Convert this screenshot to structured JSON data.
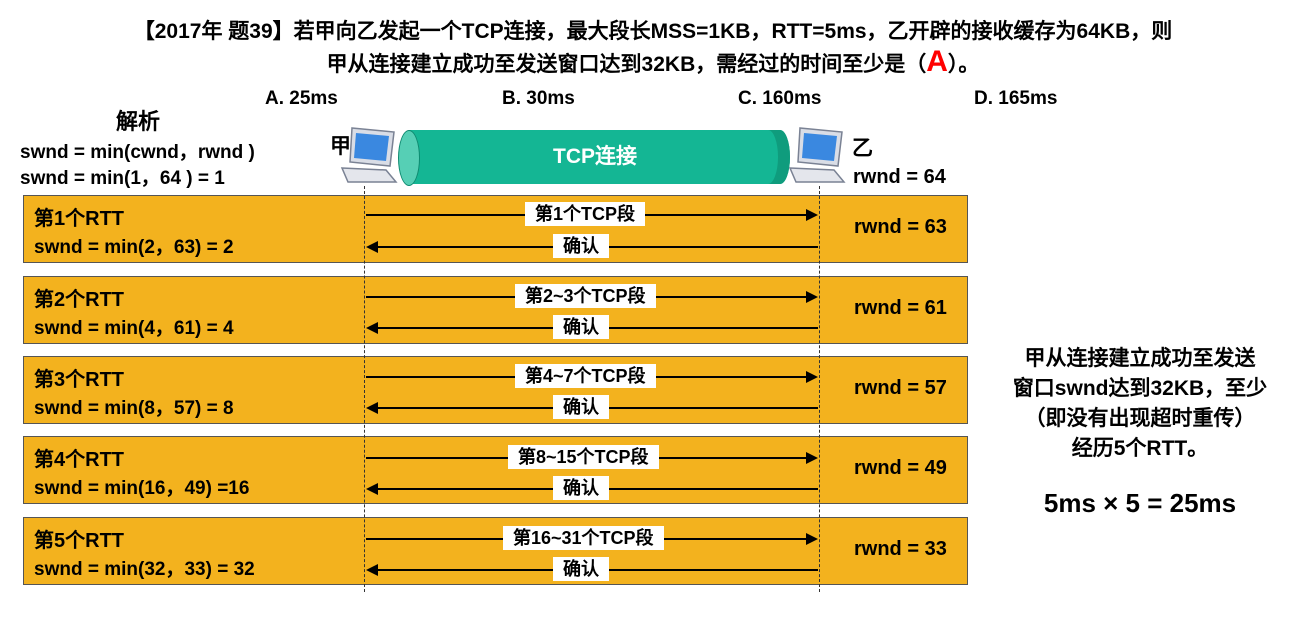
{
  "question": {
    "line1": "【2017年 题39】若甲向乙发起一个TCP连接，最大段长MSS=1KB，RTT=5ms，乙开辟的接收缓存为64KB，则",
    "line2_pre": "甲从连接建立成功至发送窗口达到32KB，需经过的时间至少是（",
    "answer": "A",
    "line2_post": "）。",
    "options": [
      "A. 25ms",
      "B. 30ms",
      "C. 160ms",
      "D. 165ms"
    ]
  },
  "analysis": {
    "title": "解析",
    "formula1": "swnd = min(cwnd，rwnd )",
    "formula2": "swnd = min(1，64 ) = 1"
  },
  "hosts": {
    "sender": "甲",
    "receiver": "乙",
    "initial_rwnd": "rwnd = 64"
  },
  "connection_label": "TCP连接",
  "rtts": [
    {
      "title": "第1个RTT",
      "swnd": "swnd = min(2，63) = 2",
      "rwnd": "rwnd = 63",
      "segment": "第1个TCP段",
      "ack": "确认"
    },
    {
      "title": "第2个RTT",
      "swnd": "swnd = min(4，61) = 4",
      "rwnd": "rwnd = 61",
      "segment": "第2~3个TCP段",
      "ack": "确认"
    },
    {
      "title": "第3个RTT",
      "swnd": "swnd = min(8，57) = 8",
      "rwnd": "rwnd = 57",
      "segment": "第4~7个TCP段",
      "ack": "确认"
    },
    {
      "title": "第4个RTT",
      "swnd": "swnd = min(16，49) =16",
      "rwnd": "rwnd = 49",
      "segment": "第8~15个TCP段",
      "ack": "确认"
    },
    {
      "title": "第5个RTT",
      "swnd": "swnd = min(32，33) = 32",
      "rwnd": "rwnd = 33",
      "segment": "第16~31个TCP段",
      "ack": "确认"
    }
  ],
  "conclusion": {
    "lines": [
      "甲从连接建立成功至发送",
      "窗口swnd达到32KB，至少",
      "（即没有出现超时重传）",
      "经历5个RTT。"
    ],
    "calc": "5ms × 5 = 25ms"
  },
  "colors": {
    "box": "#f3b21e",
    "pipe": "#14b694",
    "answer": "#ff0000"
  },
  "icons": [
    "laptop-icon"
  ]
}
